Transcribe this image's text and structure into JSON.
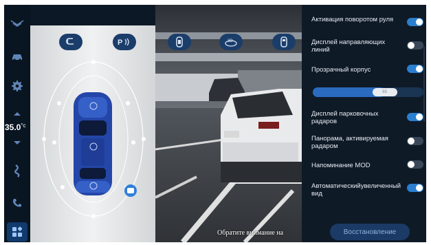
{
  "sidebar": {
    "temperature": "35.0",
    "temperature_unit": "°c",
    "items": [
      "chevron-logo-icon",
      "car-icon",
      "settings-icon",
      "fan-icon",
      "phone-icon",
      "apps-icon"
    ]
  },
  "toolbar": {
    "buttons": [
      "back-icon",
      "parking-radar-icon",
      "camera-icon",
      "3d-view-icon",
      "car-top-icon"
    ]
  },
  "camera": {
    "caption": "Обратите внимание на"
  },
  "settings": {
    "items": [
      {
        "label": "Активация поворотом руля",
        "state": "on"
      },
      {
        "label": "Дисплей направляющих линий",
        "state": "off"
      },
      {
        "label": "Прозрачный корпус",
        "state": "on"
      },
      {
        "label": "Дисплей парковочных радаров",
        "state": "on"
      },
      {
        "label": "Панорама, активируемая радаром",
        "state": "off"
      },
      {
        "label": "Напоминание MOD",
        "state": "off"
      },
      {
        "label": "Автоматическийувеличенный вид",
        "state": "on"
      }
    ],
    "transparency": {
      "value_label": "65",
      "percent": 65
    },
    "reset_label": "Восстановление"
  }
}
